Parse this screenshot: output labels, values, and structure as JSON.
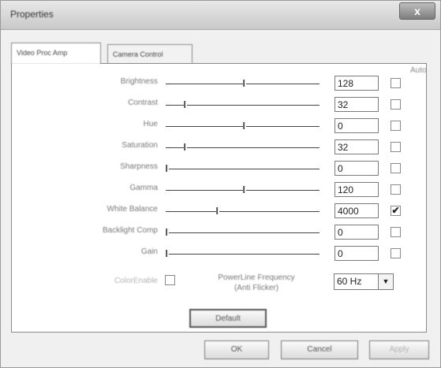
{
  "window": {
    "title": "Properties",
    "close_symbol": "x"
  },
  "tabs": [
    {
      "label": "Video Proc Amp",
      "selected": true
    },
    {
      "label": "Camera Control",
      "selected": false
    }
  ],
  "auto_header": "Auto",
  "controls": [
    {
      "label": "Brightness",
      "value": "128",
      "level": 0.5,
      "auto": false
    },
    {
      "label": "Contrast",
      "value": "32",
      "level": 0.12,
      "auto": false
    },
    {
      "label": "Hue",
      "value": "0",
      "level": 0.5,
      "auto": false
    },
    {
      "label": "Saturation",
      "value": "32",
      "level": 0.12,
      "auto": false
    },
    {
      "label": "Sharpness",
      "value": "0",
      "level": 0.0,
      "auto": false
    },
    {
      "label": "Gamma",
      "value": "120",
      "level": 0.5,
      "auto": false
    },
    {
      "label": "White Balance",
      "value": "4000",
      "level": 0.33,
      "auto": true
    },
    {
      "label": "Backlight Comp",
      "value": "0",
      "level": 0.0,
      "auto": false
    },
    {
      "label": "Gain",
      "value": "0",
      "level": 0.0,
      "auto": false
    }
  ],
  "color_enable": {
    "label": "ColorEnable",
    "checked": false
  },
  "power_line": {
    "label_line1": "PowerLine Frequency",
    "label_line2": "(Anti Flicker)",
    "selected": "60 Hz"
  },
  "buttons": {
    "default": "Default",
    "ok": "OK",
    "cancel": "Cancel",
    "apply": "Apply"
  }
}
